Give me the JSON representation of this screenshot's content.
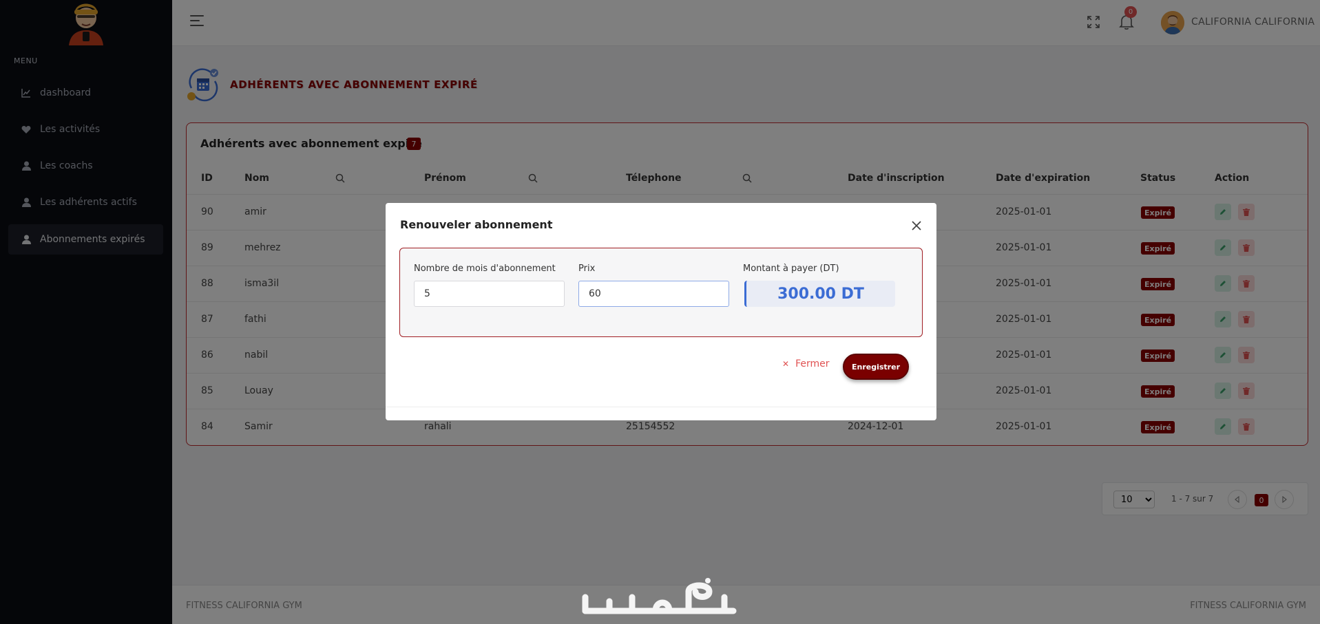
{
  "sidebar": {
    "menu_title": "MENU",
    "items": [
      {
        "label": "dashboard",
        "icon": "chart-line-icon"
      },
      {
        "label": "Les activités",
        "icon": "heart-icon"
      },
      {
        "label": "Les coachs",
        "icon": "user-icon"
      },
      {
        "label": "Les adhérents actifs",
        "icon": "user-icon"
      },
      {
        "label": "Abonnements expirés",
        "icon": "user-icon",
        "active": true
      }
    ]
  },
  "header": {
    "notification_count": "0",
    "username": "CALIFORNIA CALIFORNIA"
  },
  "page": {
    "title": "ADHÉRENTS AVEC ABONNEMENT EXPIRÉ"
  },
  "card": {
    "title": "Adhérents avec abonnement expiré",
    "count": "7",
    "columns": {
      "id": "ID",
      "nom": "Nom",
      "prenom": "Prénom",
      "telephone": "Télephone",
      "inscription": "Date d'inscription",
      "expiration": "Date d'expiration",
      "status": "Status",
      "action": "Action"
    },
    "rows": [
      {
        "id": "90",
        "nom": "amir",
        "prenom": "",
        "telephone": "",
        "inscription": "",
        "expiration": "2025-01-01",
        "status": "Expiré"
      },
      {
        "id": "89",
        "nom": "mehrez",
        "prenom": "",
        "telephone": "",
        "inscription": "",
        "expiration": "2025-01-01",
        "status": "Expiré"
      },
      {
        "id": "88",
        "nom": "isma3il",
        "prenom": "",
        "telephone": "",
        "inscription": "",
        "expiration": "2025-01-01",
        "status": "Expiré"
      },
      {
        "id": "87",
        "nom": "fathi",
        "prenom": "",
        "telephone": "",
        "inscription": "",
        "expiration": "2025-01-01",
        "status": "Expiré"
      },
      {
        "id": "86",
        "nom": "nabil",
        "prenom": "",
        "telephone": "",
        "inscription": "",
        "expiration": "2025-01-01",
        "status": "Expiré"
      },
      {
        "id": "85",
        "nom": "Louay",
        "prenom": "",
        "telephone": "",
        "inscription": "",
        "expiration": "2025-01-01",
        "status": "Expiré"
      },
      {
        "id": "84",
        "nom": "Samir",
        "prenom": "rahali",
        "telephone": "25154552",
        "inscription": "2024-12-01",
        "expiration": "2025-01-01",
        "status": "Expiré"
      }
    ]
  },
  "pagination": {
    "page_size": "10",
    "info": "1 - 7 sur 7",
    "current_page": "0"
  },
  "footer": {
    "left": "FITNESS CALIFORNIA GYM",
    "right": "FITNESS CALIFORNIA GYM",
    "watermark": "خمسات"
  },
  "modal": {
    "title": "Renouveler abonnement",
    "months_label": "Nombre de mois d'abonnement",
    "months_value": "5",
    "price_label": "Prix",
    "price_value": "60",
    "total_label": "Montant à payer (DT)",
    "total_value": "300.00 DT",
    "cancel_label": "Fermer",
    "save_label": "Enregistrer"
  },
  "colors": {
    "brand": "#8b0000",
    "sidebar_bg": "#0a0c13",
    "total_accent": "#3b6cd4"
  }
}
